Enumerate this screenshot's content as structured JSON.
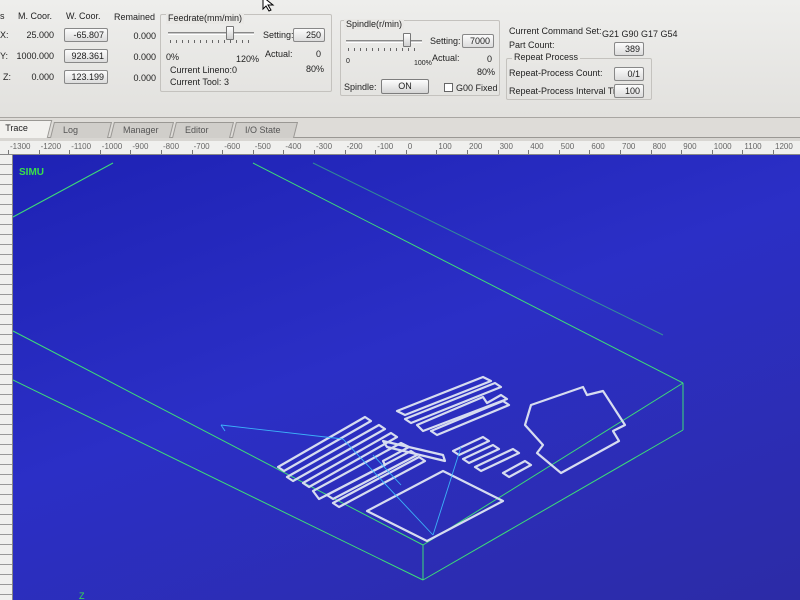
{
  "coords": {
    "header_axis": "s",
    "header_machine": "M. Coor.",
    "header_work": "W. Coor.",
    "header_remained": "Remained",
    "rows": [
      {
        "axis": "X:",
        "machine": "25.000",
        "work": "-65.807",
        "remained": "0.000"
      },
      {
        "axis": "Y:",
        "machine": "1000.000",
        "work": "928.361",
        "remained": "0.000"
      },
      {
        "axis": "Z:",
        "machine": "0.000",
        "work": "123.199",
        "remained": "0.000"
      }
    ]
  },
  "feedrate": {
    "title": "Feedrate(mm/min)",
    "setting_label": "Setting:",
    "setting_value": "250",
    "actual_label": "Actual:",
    "actual_value": "0",
    "min_label": "0%",
    "max_label": "120%",
    "percent": "80%",
    "slider_fraction": 0.72,
    "lineno_label": "Current Lineno:",
    "lineno_value": "0",
    "tool_label": "Current Tool:",
    "tool_value": "3"
  },
  "spindle": {
    "title": "Spindle(r/min)",
    "setting_label": "Setting:",
    "setting_value": "7000",
    "actual_label": "Actual:",
    "actual_value": "0",
    "min_label": "0",
    "max_label": "100%",
    "percent": "80%",
    "slider_fraction": 0.8,
    "toggle_label": "Spindle:",
    "toggle_button": "ON",
    "g00_label": "G00 Fixed"
  },
  "command": {
    "set_label": "Current Command Set:",
    "set_value": "G21 G90 G17 G54",
    "part_count_label": "Part Count:",
    "part_count_value": "389",
    "repeat_title": "Repeat Process",
    "repeat_count_label": "Repeat-Process Count:",
    "repeat_count_value": "0/1",
    "interval_label": "Repeat-Process Interval Time:",
    "interval_value": "100"
  },
  "tabs": [
    "Trace",
    "Log",
    "Manager",
    "Editor",
    "I/O State"
  ],
  "ruler": [
    "-1300",
    "-1200",
    "-1100",
    "-1000",
    "-900",
    "-800",
    "-700",
    "-600",
    "-500",
    "-400",
    "-300",
    "-200",
    "-100",
    "0",
    "100",
    "200",
    "300",
    "400",
    "500",
    "600",
    "700",
    "800",
    "900",
    "1000",
    "1100",
    "1200"
  ],
  "viewport": {
    "mode_label": "SIMU",
    "status_glyph": "Z",
    "bg_color": "#2a2dc0",
    "box_color": "#3ddc78",
    "path_color": "#d6dcf0"
  }
}
